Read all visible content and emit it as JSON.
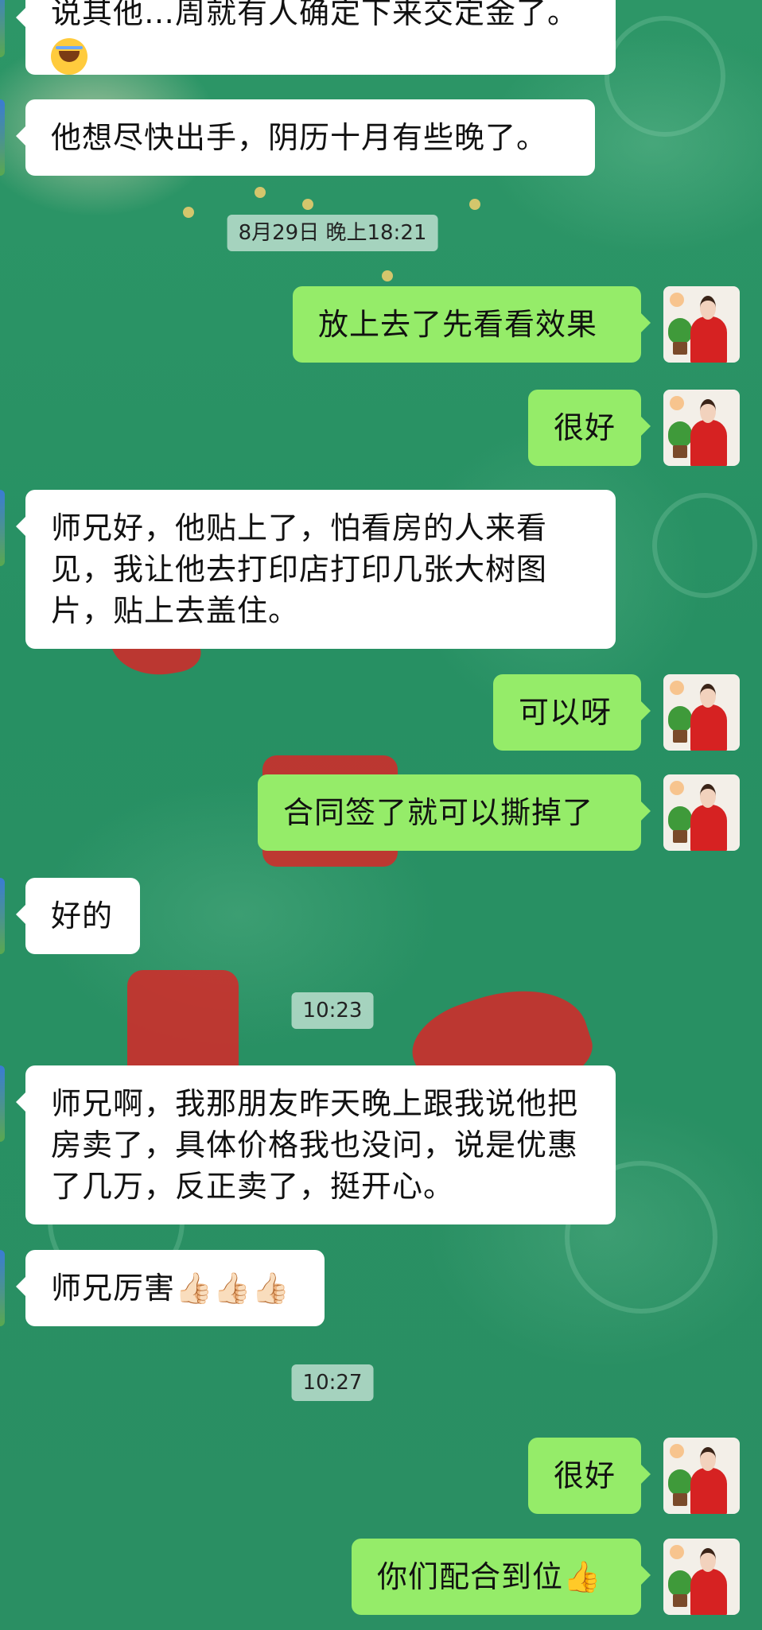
{
  "chat": {
    "messages": [
      {
        "side": "in",
        "text": "说其他…周就有人确定下来交定金了。",
        "has_laugh_emoji": true
      },
      {
        "side": "in",
        "text": "他想尽快出手，阴历十月有些晚了。"
      },
      {
        "side": "time",
        "text": "8月29日  晚上18:21"
      },
      {
        "side": "out",
        "text": "放上去了先看看效果"
      },
      {
        "side": "out",
        "text": "很好"
      },
      {
        "side": "in",
        "text": "师兄好，他贴上了，怕看房的人来看见，我让他去打印店打印几张大树图片，贴上去盖住。"
      },
      {
        "side": "out",
        "text": "可以呀"
      },
      {
        "side": "out",
        "text": "合同签了就可以撕掉了"
      },
      {
        "side": "in",
        "text": "好的"
      },
      {
        "side": "time",
        "text": "10:23"
      },
      {
        "side": "in",
        "text": "师兄啊，我那朋友昨天晚上跟我说他把房卖了，具体价格我也没问，说是优惠了几万，反正卖了，挺开心。"
      },
      {
        "side": "in",
        "text": "师兄厉害👍🏻👍🏻👍🏻"
      },
      {
        "side": "time",
        "text": "10:27"
      },
      {
        "side": "out",
        "text": "很好"
      },
      {
        "side": "out",
        "text": "你们配合到位👍"
      }
    ]
  },
  "icons": {
    "avatar": "avatar-woman-in-red",
    "laugh": "laughing-crying-emoji-icon",
    "thumbs": "thumbs-up-icon"
  },
  "colors": {
    "incoming_bubble": "#ffffff",
    "outgoing_bubble": "#95ec69",
    "background": "#2a8f63",
    "timestamp_bg": "#c8e6d7"
  }
}
